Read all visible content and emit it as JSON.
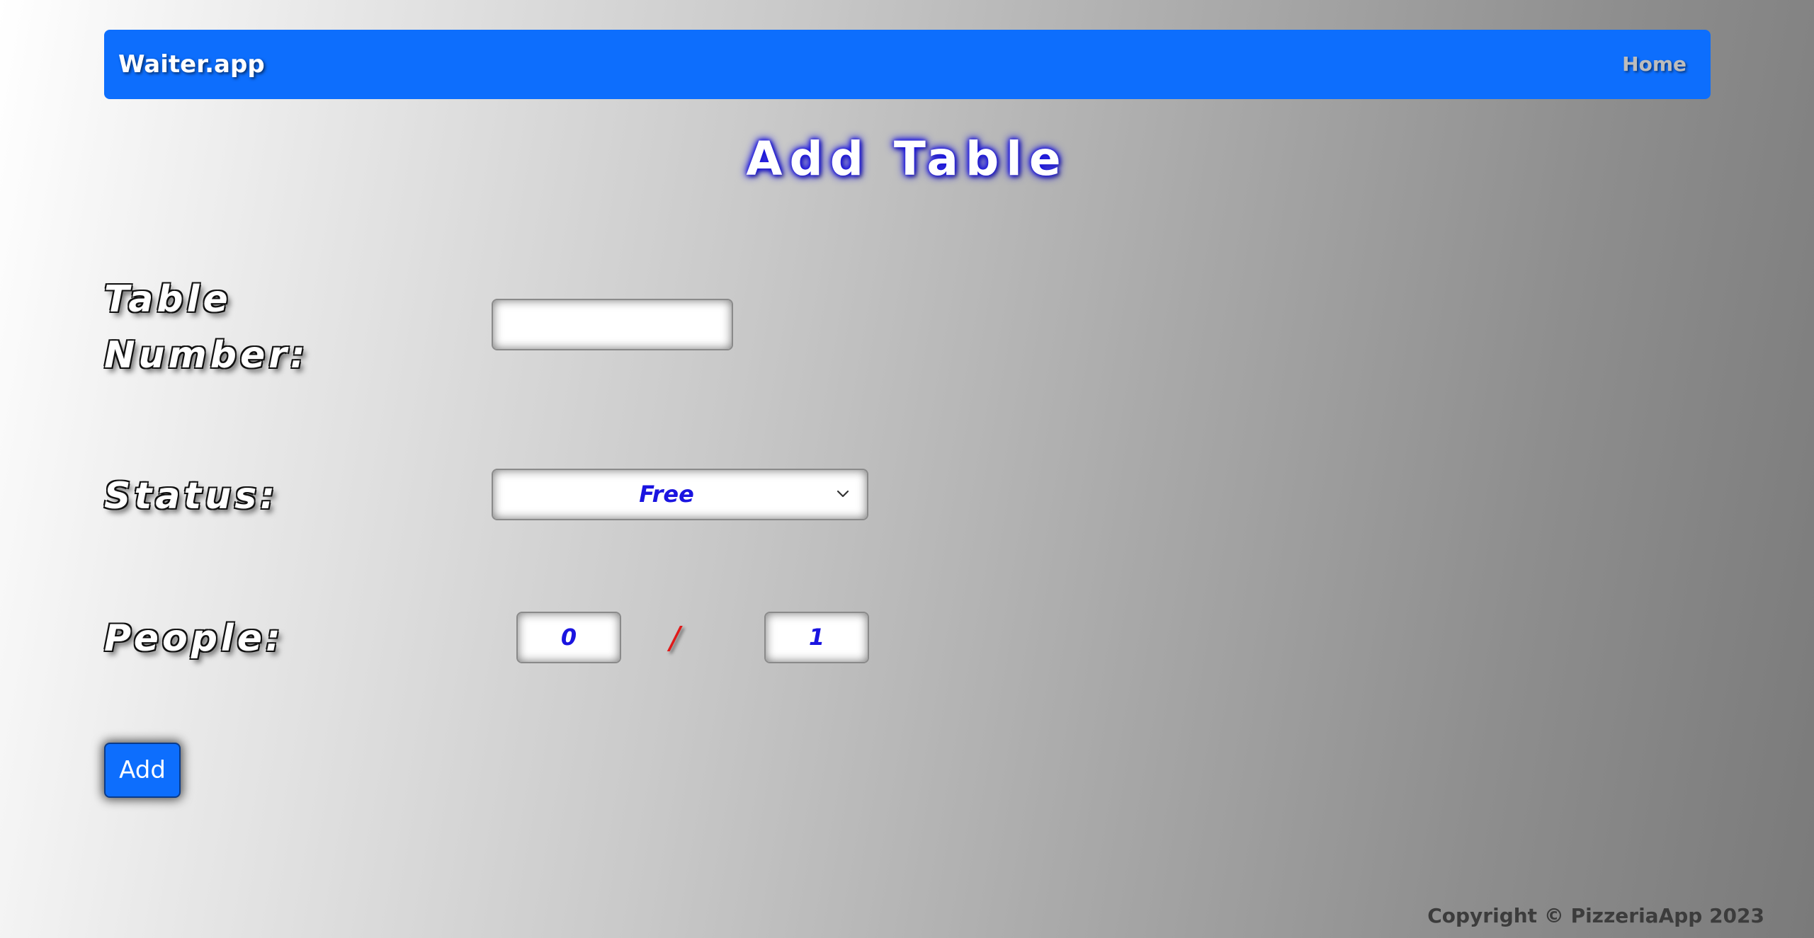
{
  "navbar": {
    "brand": "Waiter.app",
    "home_link": "Home",
    "accent_color": "#0d6efd"
  },
  "page": {
    "title": "Add Table"
  },
  "form": {
    "table_number": {
      "label": "Table Number:",
      "value": ""
    },
    "status": {
      "label": "Status:",
      "selected": "Free",
      "icon": "chevron-down-icon"
    },
    "people": {
      "label": "People:",
      "current": "0",
      "separator": "/",
      "max": "1"
    },
    "submit_label": "Add"
  },
  "footer": {
    "copyright": "Copyright © PizzeriaApp 2023"
  }
}
